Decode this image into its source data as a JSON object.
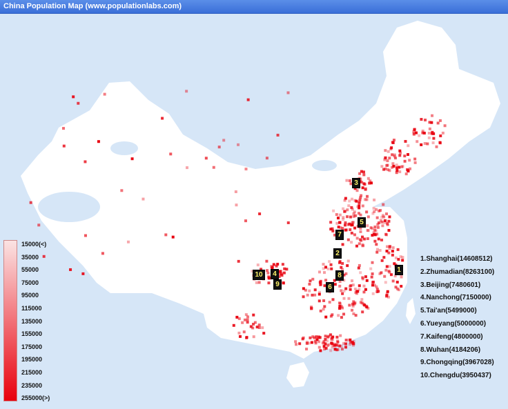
{
  "title": "China Population Map (www.populationlabs.com)",
  "colors": {
    "background": "#d6e6f7",
    "land": "#ffffff",
    "dot_low": "#fbe3e3",
    "dot_high": "#e8000d",
    "marker_bg": "#111111",
    "marker_text": "#fff36a"
  },
  "legend": {
    "labels": [
      "15000(<)",
      "35000",
      "55000",
      "75000",
      "95000",
      "115000",
      "135000",
      "155000",
      "175000",
      "195000",
      "215000",
      "235000",
      "255000(>)"
    ]
  },
  "cities": [
    {
      "rank": "1",
      "label": "1.Shanghai(14608512)"
    },
    {
      "rank": "2",
      "label": "2.Zhumadian(8263100)"
    },
    {
      "rank": "3",
      "label": "3.Beijing(7480601)"
    },
    {
      "rank": "4",
      "label": "4.Nanchong(7150000)"
    },
    {
      "rank": "5",
      "label": "5.Tai'an(5499000)"
    },
    {
      "rank": "6",
      "label": "6.Yueyang(5000000)"
    },
    {
      "rank": "7",
      "label": "7.Kaifeng(4800000)"
    },
    {
      "rank": "8",
      "label": "8.Wuhan(4184206)"
    },
    {
      "rank": "9",
      "label": "9.Chongqing(3967028)"
    },
    {
      "rank": "10",
      "label": "10.Chengdu(3950437)"
    }
  ]
}
